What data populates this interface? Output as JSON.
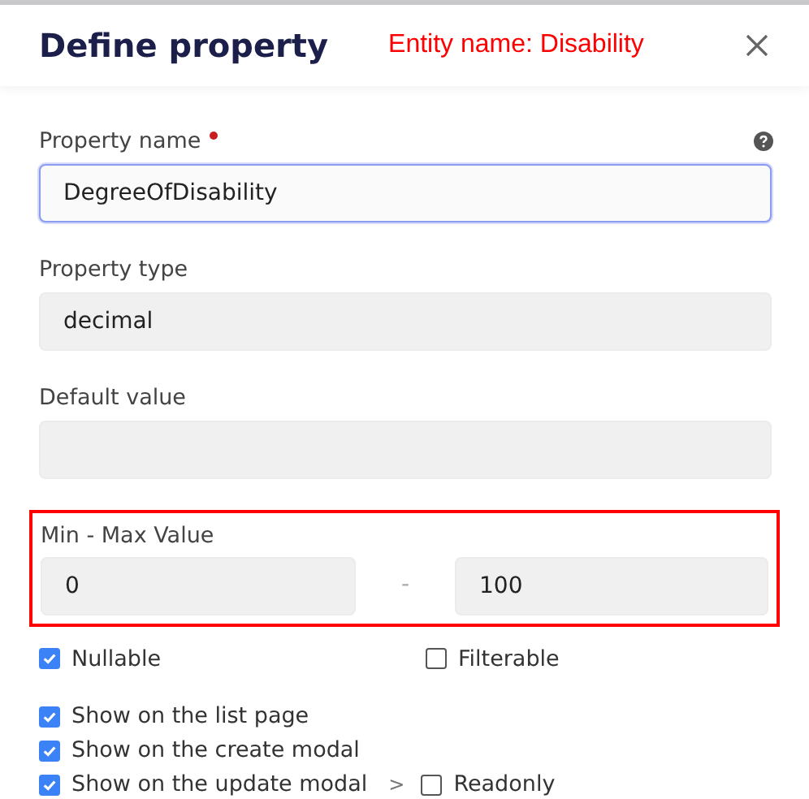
{
  "header": {
    "title": "Define property",
    "entity_name": "Entity name: Disability"
  },
  "fields": [
    {
      "label": "Property name",
      "required": true,
      "help": true,
      "value": "DegreeOfDisability",
      "focused": true,
      "disabled": false
    },
    {
      "label": "Property type",
      "required": false,
      "help": false,
      "value": "decimal",
      "focused": false,
      "disabled": true
    },
    {
      "label": "Default value",
      "required": false,
      "help": false,
      "focused": false,
      "disabled": true
    }
  ],
  "range": {
    "label": "Min - Max Value",
    "highlighted": true,
    "min": "0",
    "separator": "-",
    "max": "100"
  },
  "flags": [
    {
      "label": "Nullable",
      "checked": true
    },
    {
      "label": "Filterable",
      "checked": false
    }
  ],
  "visibility": [
    {
      "label": "Show on the list page",
      "checked": true
    },
    {
      "label": "Show on the create modal",
      "checked": true
    },
    {
      "label": "Show on the update modal",
      "checked": true,
      "sub": {
        "arrow": ">",
        "label": "Readonly",
        "checked": false
      }
    }
  ]
}
